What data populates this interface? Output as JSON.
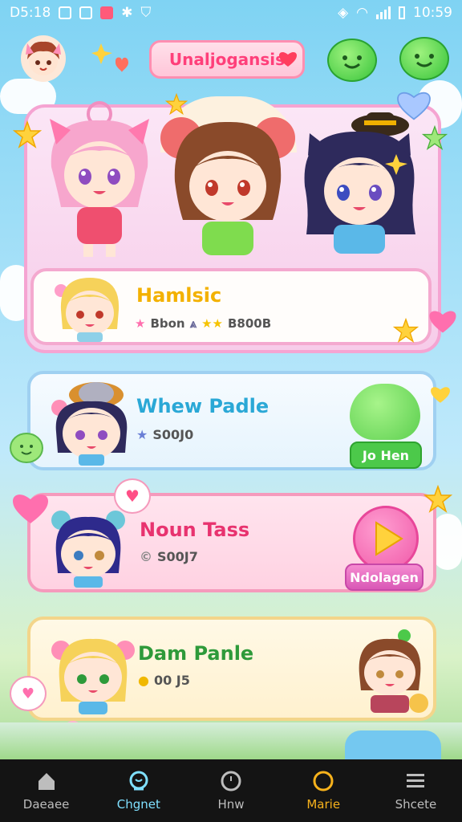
{
  "status_bar": {
    "time_left": "D5:18",
    "time_right": "10:59"
  },
  "header": {
    "title": "Unaljogansis"
  },
  "featured": {
    "name": "Hamlsic",
    "score": "Bbon",
    "score_value": "B800B"
  },
  "cards": [
    {
      "name": "Whew Padle",
      "score": "S00J0",
      "button_label": "Jo Hen",
      "color": "#2aa8d6"
    },
    {
      "name": "Noun Tass",
      "score": "S00J7",
      "button_label": "Ndolagen",
      "color": "#e8336f"
    },
    {
      "name": "Dam Panle",
      "score": "00 J5",
      "color": "#2e9a3a"
    }
  ],
  "nav": {
    "active": "Chgnet",
    "items": [
      {
        "label": "Daeaee",
        "icon": "home-icon"
      },
      {
        "label": "Chgnet",
        "icon": "chat-icon"
      },
      {
        "label": "Hnw",
        "icon": "circle-icon"
      },
      {
        "label": "Marie",
        "icon": "ring-icon"
      },
      {
        "label": "Shcete",
        "icon": "menu-icon"
      }
    ]
  },
  "colors": {
    "accent_pink": "#ff4f86",
    "accent_green": "#4cc94a",
    "accent_blue": "#2aa8d6",
    "nav_active": "#7fe0ff",
    "nav_highlight": "#f7b21c"
  }
}
